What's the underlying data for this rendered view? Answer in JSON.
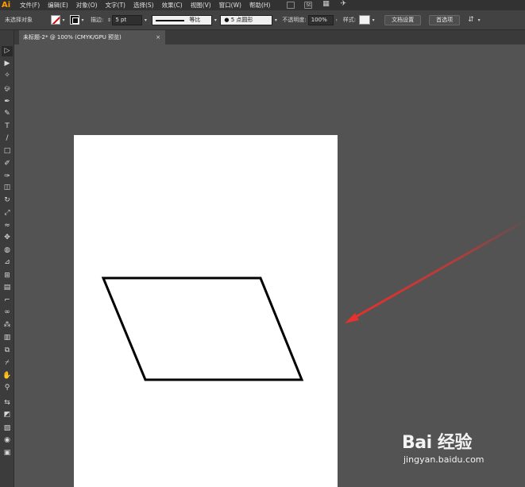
{
  "app": {
    "logo": "Ai"
  },
  "menubar": {
    "items": [
      "文件(F)",
      "编辑(E)",
      "对象(O)",
      "文字(T)",
      "选择(S)",
      "效果(C)",
      "视图(V)",
      "窗口(W)",
      "帮助(H)"
    ],
    "icons": [
      {
        "name": "arrange-documents-icon",
        "glyph": ""
      },
      {
        "name": "stock-icon",
        "glyph": "St"
      },
      {
        "name": "workspace-layout-icon",
        "glyph": "▦"
      },
      {
        "name": "publish-icon",
        "glyph": "✈"
      }
    ]
  },
  "controlbar": {
    "no_selection": "未选择对象",
    "stroke_label": "描边",
    "stroke_weight": "5 pt",
    "stroke_profile": "等比",
    "brush": "5 点圆形",
    "opacity_label": "不透明度",
    "opacity_value": "100%",
    "style_label": "样式",
    "doc_setup": "文档设置",
    "preferences": "首选项"
  },
  "tab": {
    "title": "未标题-2* @ 100% (CMYK/GPU 预览)",
    "close": "×"
  },
  "toolbar": {
    "tools": [
      {
        "name": "selection-tool-icon",
        "glyph": "▷"
      },
      {
        "name": "direct-selection-tool-icon",
        "glyph": "▶"
      },
      {
        "name": "magic-wand-tool-icon",
        "glyph": "✧"
      },
      {
        "name": "lasso-tool-icon",
        "glyph": "ஓ"
      },
      {
        "name": "pen-tool-icon",
        "glyph": "✒"
      },
      {
        "name": "curvature-tool-icon",
        "glyph": "✎"
      },
      {
        "name": "type-tool-icon",
        "glyph": "T"
      },
      {
        "name": "line-segment-tool-icon",
        "glyph": "/"
      },
      {
        "name": "rectangle-tool-icon",
        "glyph": "□"
      },
      {
        "name": "paintbrush-tool-icon",
        "glyph": "✐"
      },
      {
        "name": "shaper-tool-icon",
        "glyph": "✑"
      },
      {
        "name": "eraser-tool-icon",
        "glyph": "◫"
      },
      {
        "name": "rotate-tool-icon",
        "glyph": "↻"
      },
      {
        "name": "scale-tool-icon",
        "glyph": "⤢"
      },
      {
        "name": "warp-tool-icon",
        "glyph": "≈"
      },
      {
        "name": "free-transform-tool-icon",
        "glyph": "✥"
      },
      {
        "name": "shape-builder-tool-icon",
        "glyph": "◍"
      },
      {
        "name": "perspective-grid-tool-icon",
        "glyph": "⊿"
      },
      {
        "name": "mesh-tool-icon",
        "glyph": "⊞"
      },
      {
        "name": "gradient-tool-icon",
        "glyph": "▤"
      },
      {
        "name": "eyedropper-tool-icon",
        "glyph": "⌐"
      },
      {
        "name": "blend-tool-icon",
        "glyph": "∞"
      },
      {
        "name": "symbol-sprayer-tool-icon",
        "glyph": "⁂"
      },
      {
        "name": "column-graph-tool-icon",
        "glyph": "▥"
      },
      {
        "name": "artboard-tool-icon",
        "glyph": "⧉"
      },
      {
        "name": "slice-tool-icon",
        "glyph": "⌿"
      },
      {
        "name": "hand-tool-icon",
        "glyph": "✋"
      },
      {
        "name": "zoom-tool-icon",
        "glyph": "⚲"
      },
      {
        "name": "default-colors-icon",
        "glyph": "⇆"
      },
      {
        "name": "fill-stroke-icon",
        "glyph": "◩"
      },
      {
        "name": "color-mode-icon",
        "glyph": "▨"
      },
      {
        "name": "draw-mode-icon",
        "glyph": "◉"
      },
      {
        "name": "screen-mode-icon",
        "glyph": "▣"
      }
    ]
  },
  "canvas": {
    "shape": "parallelogram",
    "stroke_color": "#000000",
    "annotation_arrow_color": "#e8302c"
  },
  "watermark": {
    "logo": "Bai 经验",
    "url": "jingyan.baidu.com"
  }
}
